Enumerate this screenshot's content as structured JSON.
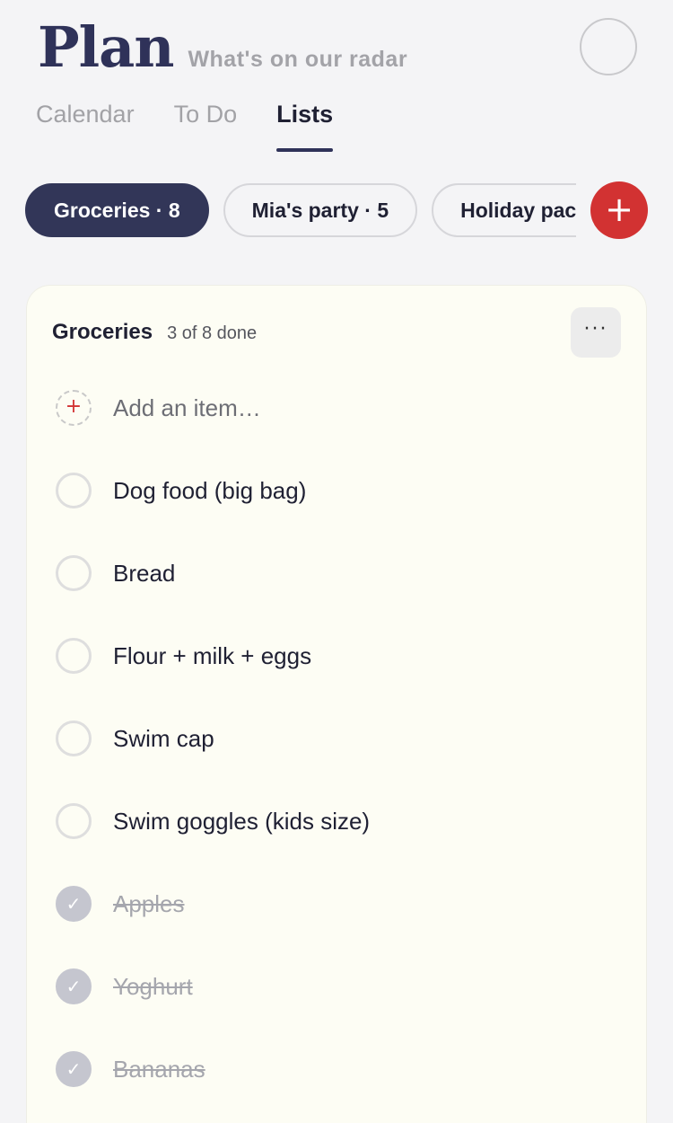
{
  "header": {
    "title": "Plan",
    "subtitle": "What's on our radar"
  },
  "tabs": [
    {
      "label": "Calendar",
      "active": false
    },
    {
      "label": "To Do",
      "active": false
    },
    {
      "label": "Lists",
      "active": true
    }
  ],
  "lists": [
    {
      "label": "Groceries · 8",
      "active": true
    },
    {
      "label": "Mia's party · 5",
      "active": false
    },
    {
      "label": "Holiday packing",
      "active": false
    }
  ],
  "add_list_icon": "plus-icon",
  "card": {
    "title": "Groceries",
    "count": "3 of 8 done",
    "more_label": "···",
    "add_placeholder": "Add an item…",
    "add_icon": "+",
    "check_glyph": "✓",
    "items": [
      {
        "label": "Dog food (big bag)",
        "done": false
      },
      {
        "label": "Bread",
        "done": false
      },
      {
        "label": "Flour + milk + eggs",
        "done": false
      },
      {
        "label": "Swim cap",
        "done": false
      },
      {
        "label": "Swim goggles (kids size)",
        "done": false
      },
      {
        "label": "Apples",
        "done": true
      },
      {
        "label": "Yoghurt",
        "done": true
      },
      {
        "label": "Bananas",
        "done": true
      }
    ]
  },
  "colors": {
    "brand_navy": "#2f3259",
    "accent_red": "#d23232",
    "card_bg": "#fdfdf4",
    "page_bg": "#f4f4f6"
  }
}
